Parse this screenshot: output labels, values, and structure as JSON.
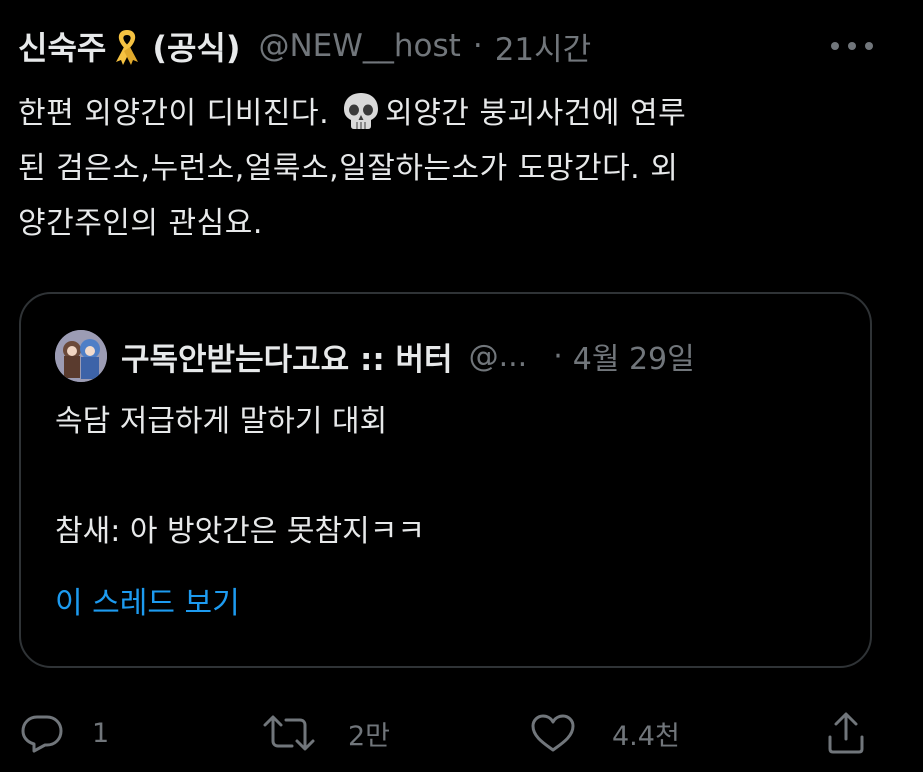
{
  "tweet": {
    "display_name": "신숙주",
    "display_name_suffix": "(공식)",
    "handle": "@NEW__host",
    "separator": "·",
    "time": "21시간",
    "text_lines": [
      {
        "before": "한편 외양간이 디비진다.",
        "emoji": "skull-icon",
        "after": "외양간 붕괴사건에 연루"
      },
      {
        "text": "된 검은소,누런소,얼룩소,일잘하는소가 도망간다. 외"
      },
      {
        "text": "양간주인의 관심요."
      }
    ]
  },
  "quote": {
    "name": "구독안받는다고요 :: 버터",
    "handle": "@...",
    "separator": "·",
    "time": "4월 29일",
    "lines": [
      "속담 저급하게 말하기 대회",
      "",
      "참새: 아 방앗간은 못참지ㅋㅋ"
    ],
    "thread_link": "이 스레드 보기"
  },
  "actions": {
    "reply_count": "1",
    "retweet_count": "2만",
    "like_count": "4.4천"
  },
  "colors": {
    "background": "#000000",
    "text": "#e7e9ea",
    "muted": "#71767b",
    "link": "#1d9bf0",
    "border": "#2f3336",
    "ribbon": "#f5c242"
  }
}
